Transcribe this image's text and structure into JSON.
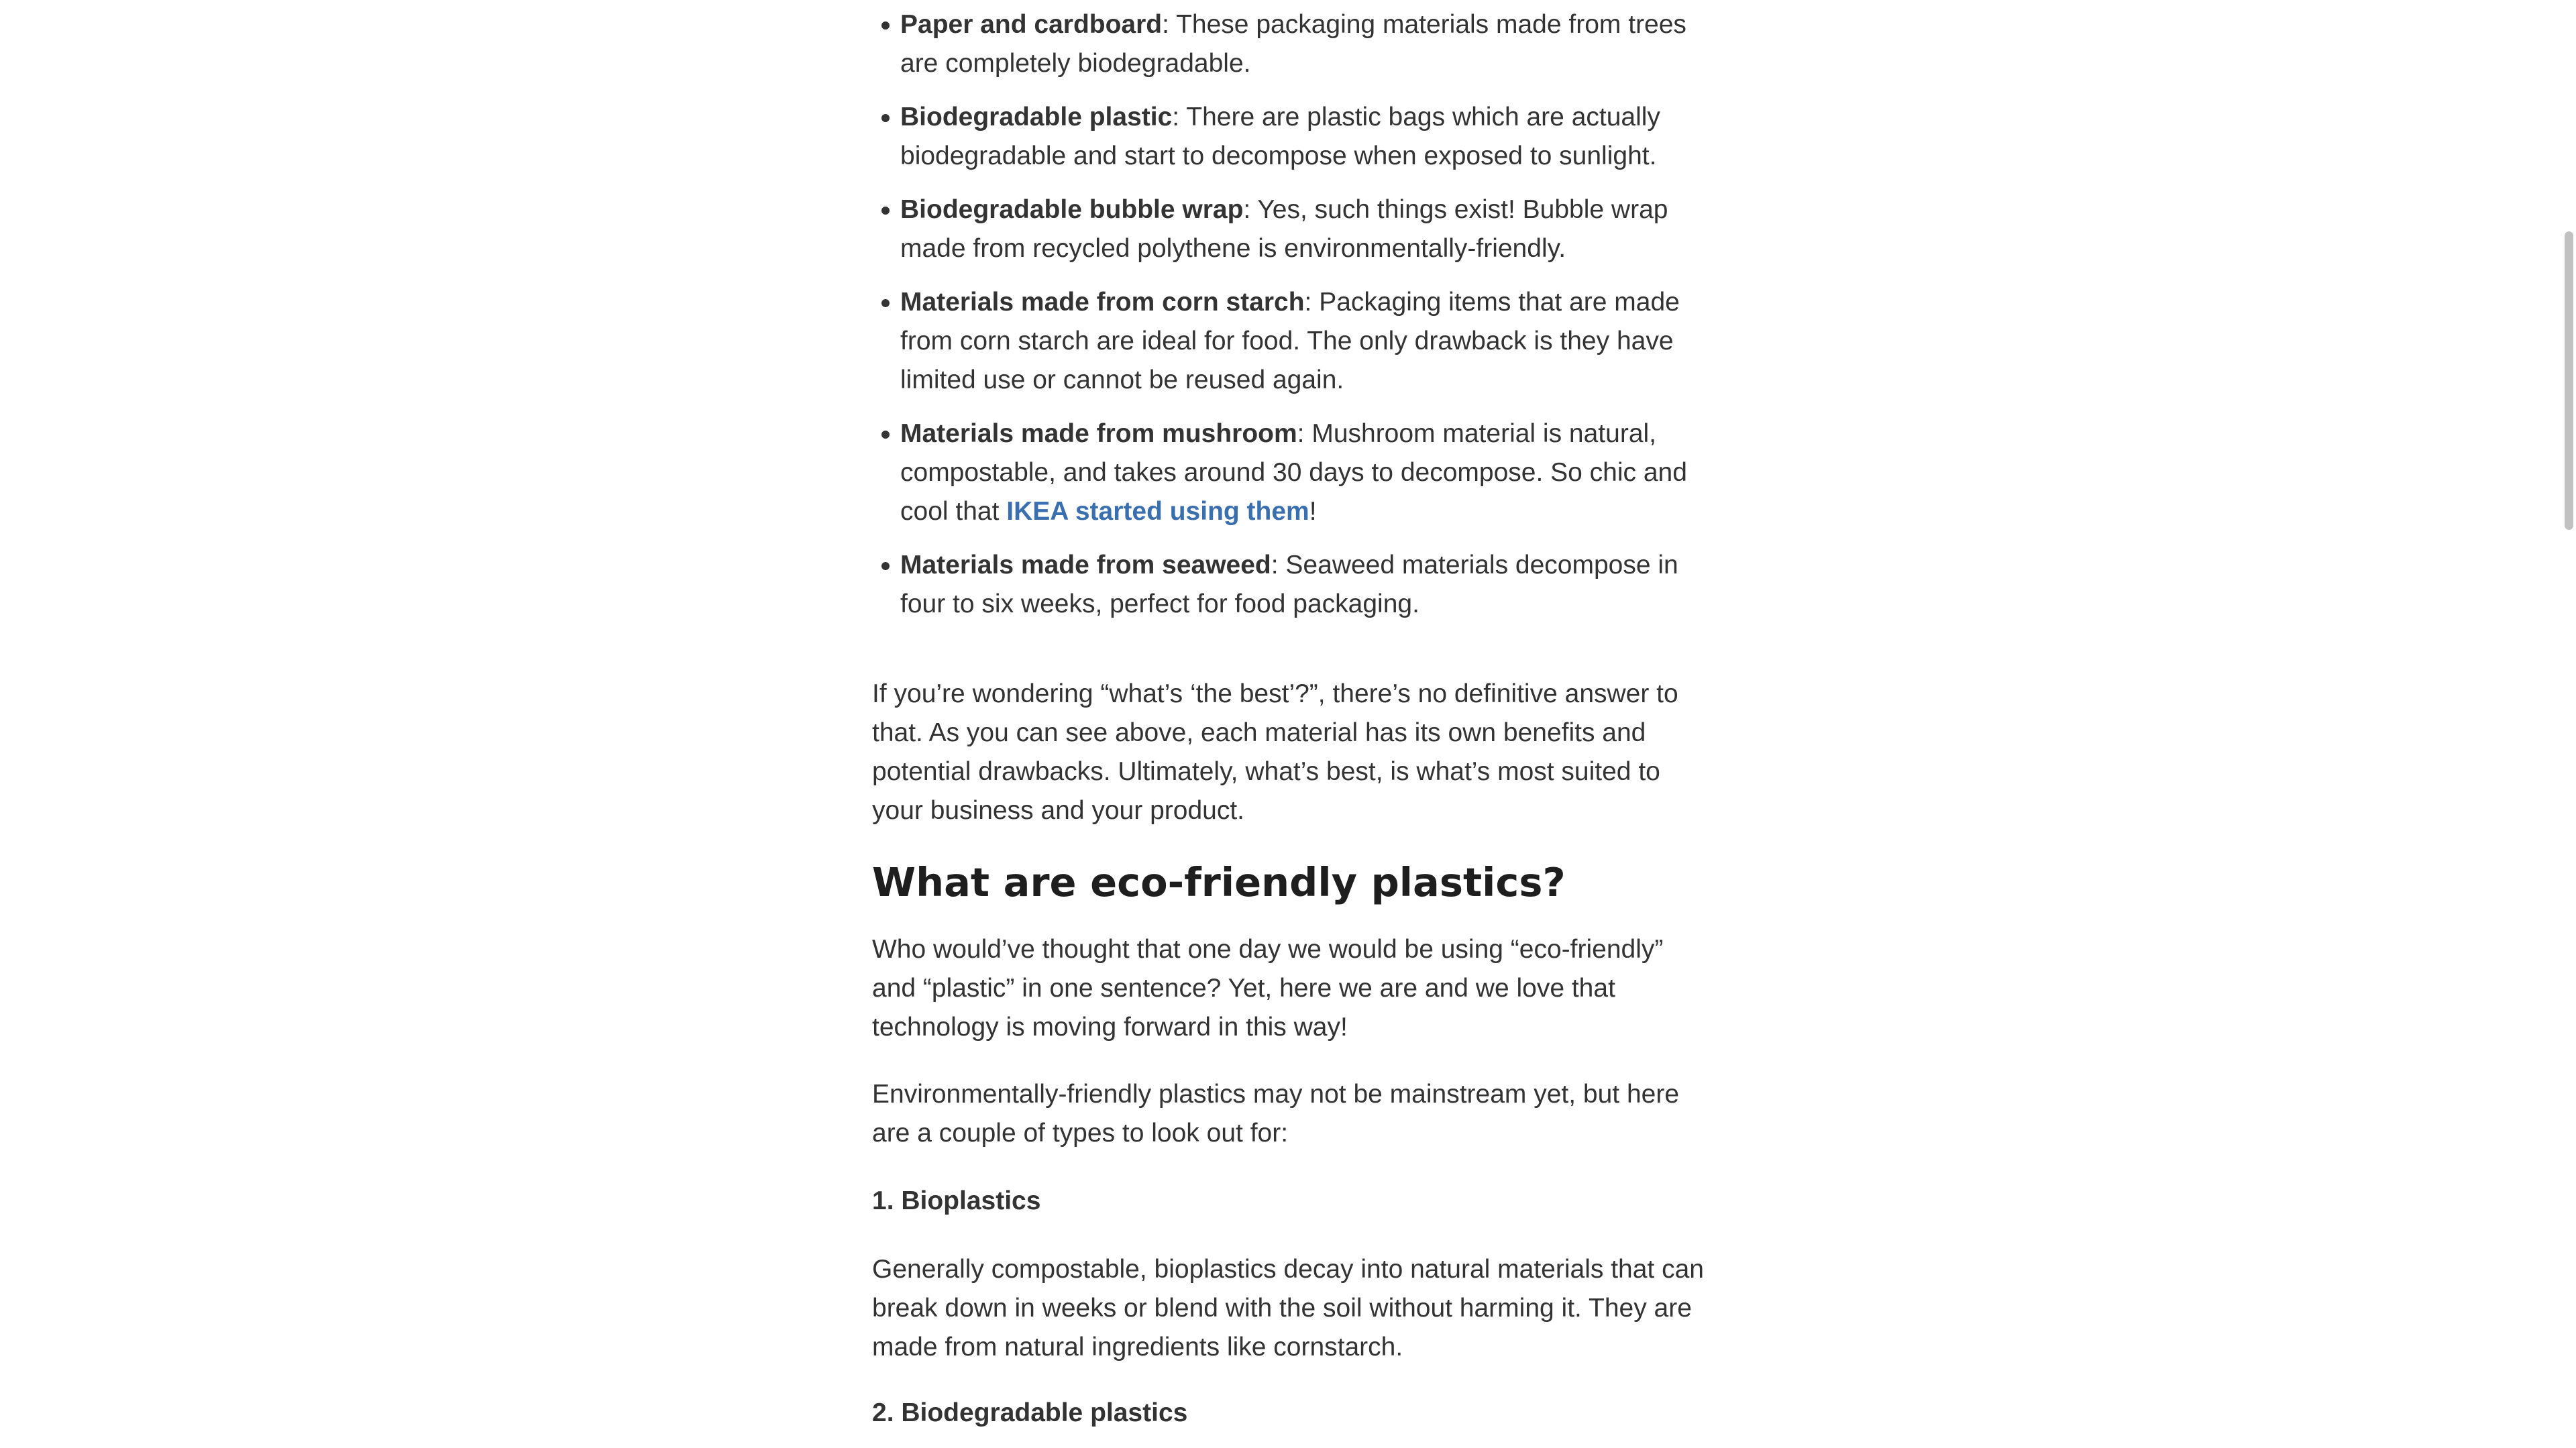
{
  "materials": [
    {
      "term": "Paper and cardboard",
      "text": ": These packaging materials made from trees are completely biodegradable."
    },
    {
      "term": "Biodegradable plastic",
      "text": ": There are plastic bags which are actually biodegradable and start to decompose when exposed to sunlight."
    },
    {
      "term": "Biodegradable bubble wrap",
      "text": ": Yes, such things exist! Bubble wrap made from recycled polythene is environmentally-friendly."
    },
    {
      "term": "Materials made from corn starch",
      "text": ": Packaging items that are made from corn starch are ideal for food. The only drawback is they have limited use or cannot be reused again."
    },
    {
      "term": "Materials made from mushroom",
      "text_before": ": Mushroom material is natural, compostable, and takes around 30 days to decompose. So chic and cool that ",
      "link": "IKEA started using them",
      "text_after": "!"
    },
    {
      "term": "Materials made from seaweed",
      "text": ": Seaweed materials decompose in four to six weeks, perfect for food packaging."
    }
  ],
  "paragraph_best": "If you’re wondering “what’s ‘the best’?”, there’s no definitive answer to that. As you can see above, each material has its own benefits and potential drawbacks. Ultimately, what’s best, is what’s most suited to your business and your product.",
  "heading_plastics": "What are eco-friendly plastics?",
  "paragraph_who": "Who would’ve thought that one day we would be using “eco-friendly” and “plastic” in one sentence? Yet, here we are and we love that technology is moving forward in this way!",
  "paragraph_env": "Environmentally-friendly plastics may not be mainstream yet, but here are a couple of types to look out for:",
  "subhead_bioplastics": "1. Bioplastics",
  "paragraph_bioplastics": "Generally compostable, bioplastics decay into natural materials that can break down in weeks or blend with the soil without harming it. They are made from natural ingredients like cornstarch.",
  "subhead_biodegradable": "2. Biodegradable plastics",
  "colors": {
    "text": "#333333",
    "heading": "#1e1e1e",
    "link": "#3a6faf",
    "scrollbar_thumb": "#c1c1c1"
  }
}
